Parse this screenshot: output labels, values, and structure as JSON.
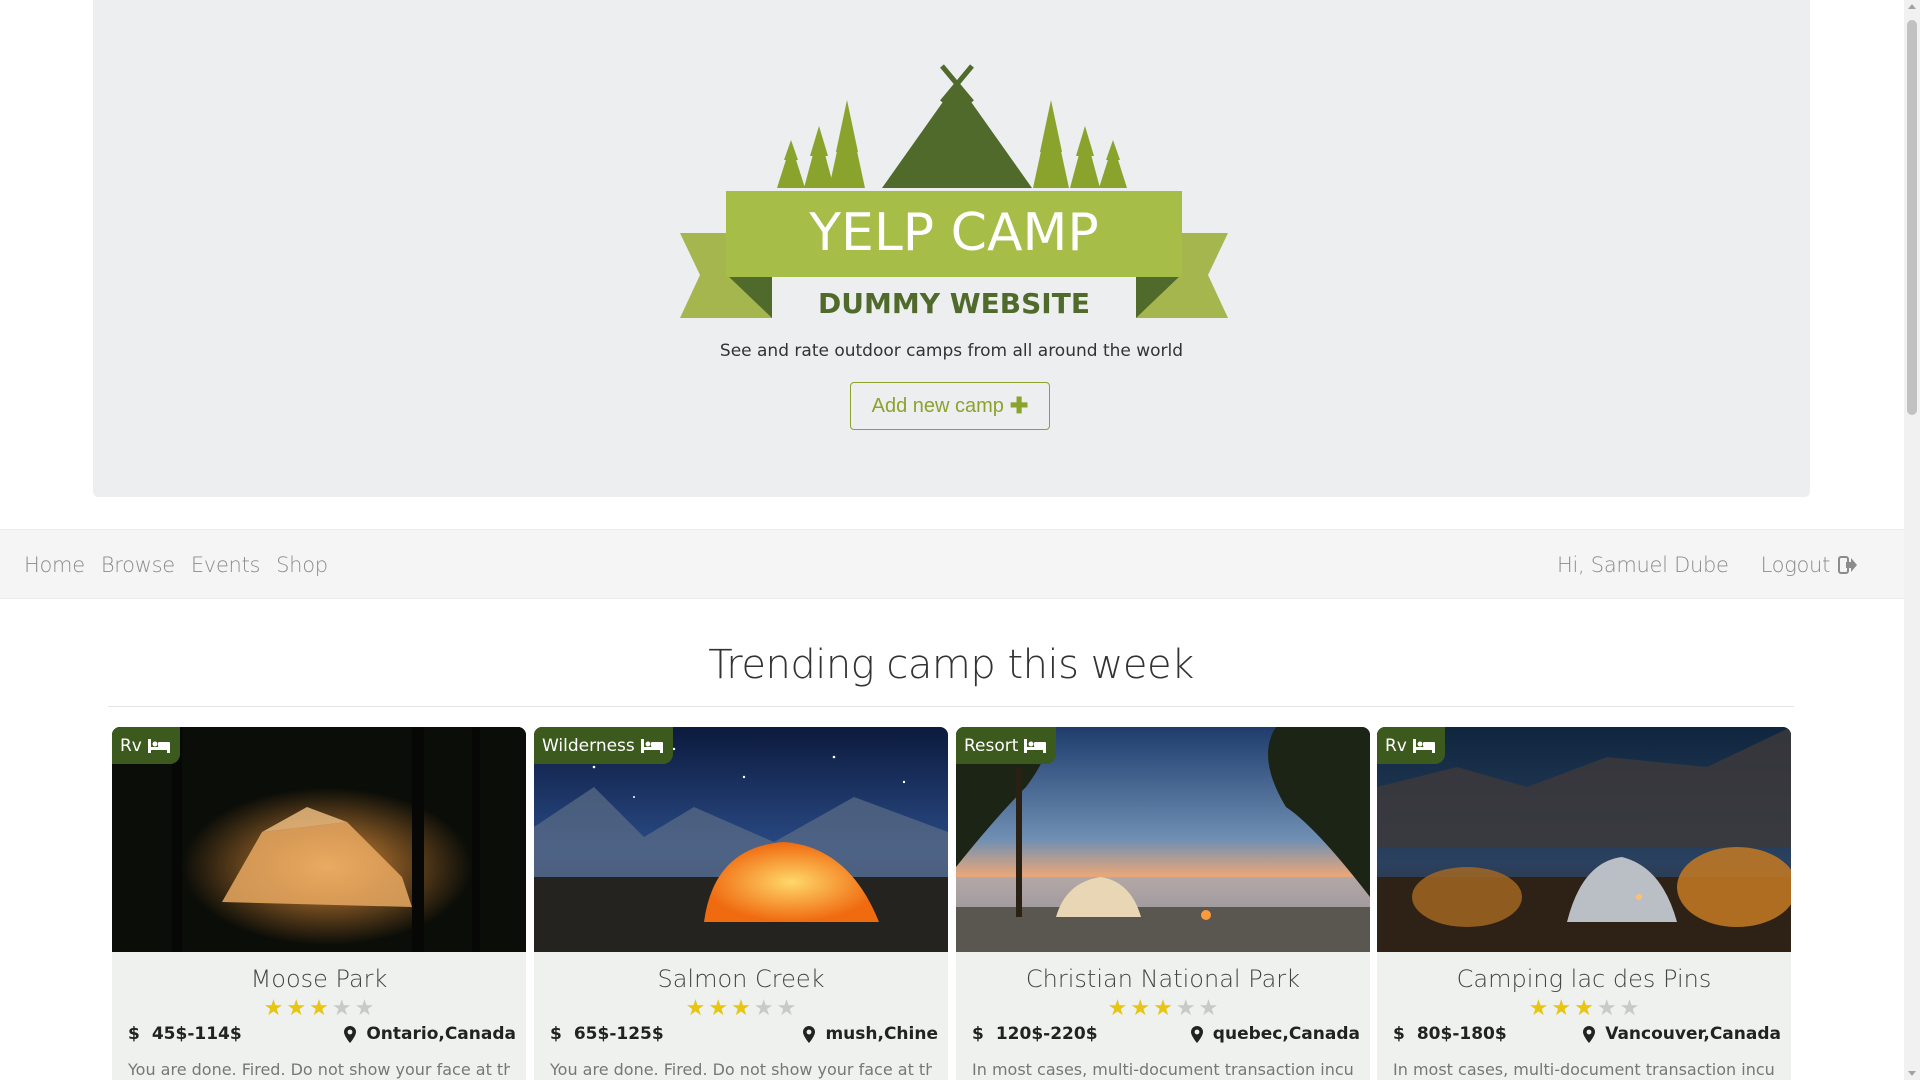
{
  "jumbotron": {
    "logo_title": "YELP CAMP",
    "logo_subtitle": "DUMMY WEBSITE",
    "tagline": "See and rate outdoor camps from all around the world",
    "add_button_label": "Add new camp"
  },
  "nav": {
    "links": [
      "Home",
      "Browse",
      "Events",
      "Shop"
    ],
    "greeting": "Hi, Samuel Dube",
    "logout_label": "Logout"
  },
  "trending": {
    "title": "Trending camp this week",
    "cards": [
      {
        "badge": "Rv",
        "name": "Moose Park",
        "rating": 3,
        "price": "45$-114$",
        "location": "Ontario,Canada",
        "description": "You are done. Fired. Do not show your face at the"
      },
      {
        "badge": "Wilderness",
        "name": "Salmon Creek",
        "rating": 3,
        "price": "65$-125$",
        "location": "mush,Chine",
        "description": "You are done. Fired. Do not show your face at the"
      },
      {
        "badge": "Resort",
        "name": "Christian National Park",
        "rating": 3,
        "price": "120$-220$",
        "location": "quebec,Canada",
        "description": "In most cases, multi-document transaction incurs a"
      },
      {
        "badge": "Rv",
        "name": "Camping lac des Pins",
        "rating": 3,
        "price": "80$-180$",
        "location": "Vancouver,Canada",
        "description": "In most cases, multi-document transaction incurs a"
      }
    ]
  },
  "colors": {
    "accent": "#8aa32c",
    "badge_bg": "#3c5a1e",
    "star_on": "#e8c512",
    "star_off": "#c9c9c9"
  },
  "icons": [
    "plus-icon",
    "bed-icon",
    "dollar-icon",
    "map-marker-icon",
    "logout-icon",
    "star-icon"
  ]
}
